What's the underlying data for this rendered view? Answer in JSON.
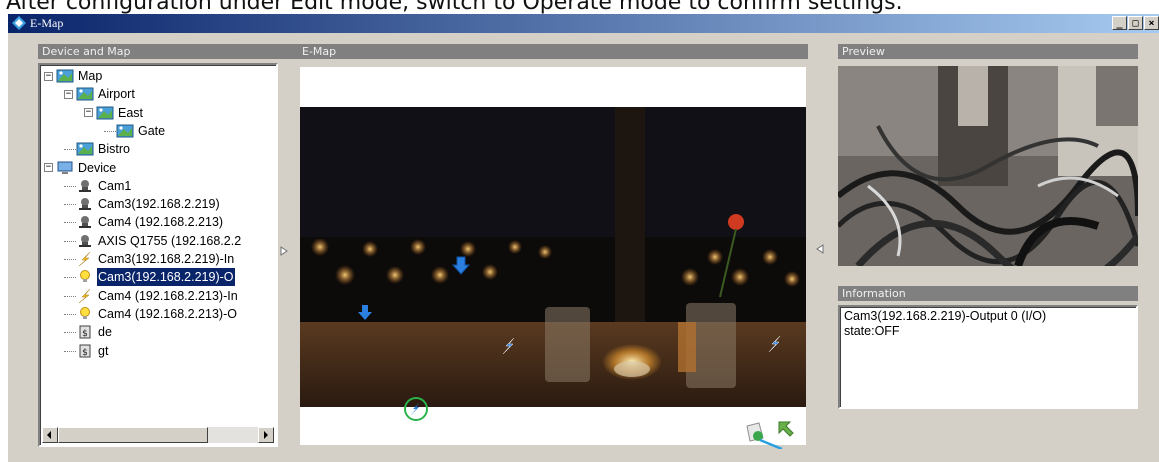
{
  "document": {
    "caption": "After configuration under Edit mode, switch to Operate mode to confirm settings."
  },
  "window": {
    "title": "E-Map",
    "controls": [
      "minimize",
      "restore",
      "close"
    ]
  },
  "panels": {
    "device_and_map": {
      "title": "Device and Map"
    },
    "emap": {
      "title": "E-Map"
    },
    "preview": {
      "title": "Preview"
    },
    "information": {
      "title": "Information",
      "line1": "Cam3(192.168.2.219)-Output 0 (I/O)",
      "line2": "state:OFF"
    }
  },
  "tree": {
    "items": [
      {
        "label": "Map",
        "icon": "map-icon",
        "expander": "−",
        "level": 0
      },
      {
        "label": "Airport",
        "icon": "map-icon",
        "expander": "−",
        "level": 1
      },
      {
        "label": "East",
        "icon": "map-icon",
        "expander": "−",
        "level": 2
      },
      {
        "label": "Gate",
        "icon": "map-icon",
        "expander": "",
        "level": 3
      },
      {
        "label": "Bistro",
        "icon": "map-icon",
        "expander": "",
        "level": 1
      },
      {
        "label": "Device",
        "icon": "computer-icon",
        "expander": "−",
        "level": 0
      },
      {
        "label": "Cam1",
        "icon": "camera-icon",
        "expander": "",
        "level": 1
      },
      {
        "label": "Cam3(192.168.2.219)",
        "icon": "camera-icon",
        "expander": "",
        "level": 1
      },
      {
        "label": "Cam4 (192.168.2.213)",
        "icon": "camera-icon",
        "expander": "",
        "level": 1
      },
      {
        "label": "AXIS Q1755 (192.168.2.2",
        "icon": "camera-icon",
        "expander": "",
        "level": 1
      },
      {
        "label": "Cam3(192.168.2.219)-In",
        "icon": "input-lightning-icon",
        "expander": "",
        "level": 1
      },
      {
        "label": "Cam3(192.168.2.219)-O",
        "icon": "output-bulb-icon",
        "expander": "",
        "level": 1,
        "selected": true
      },
      {
        "label": "Cam4 (192.168.2.213)-In",
        "icon": "input-lightning-icon",
        "expander": "",
        "level": 1
      },
      {
        "label": "Cam4 (192.168.2.213)-O",
        "icon": "output-bulb-icon",
        "expander": "",
        "level": 1
      },
      {
        "label": "de",
        "icon": "server-icon",
        "expander": "",
        "level": 1
      },
      {
        "label": "gt",
        "icon": "server-icon",
        "expander": "",
        "level": 1
      }
    ]
  },
  "colors": {
    "title_gradient_start": "#0a246a",
    "title_gradient_end": "#a6caf0",
    "panel_header": "#808080",
    "selection": "#0a246a",
    "camera_marker": "#2a7fe0",
    "selected_ring": "#29b34a"
  },
  "emap_bottom_icons": [
    "edit-mode-icon",
    "go-up-icon"
  ]
}
